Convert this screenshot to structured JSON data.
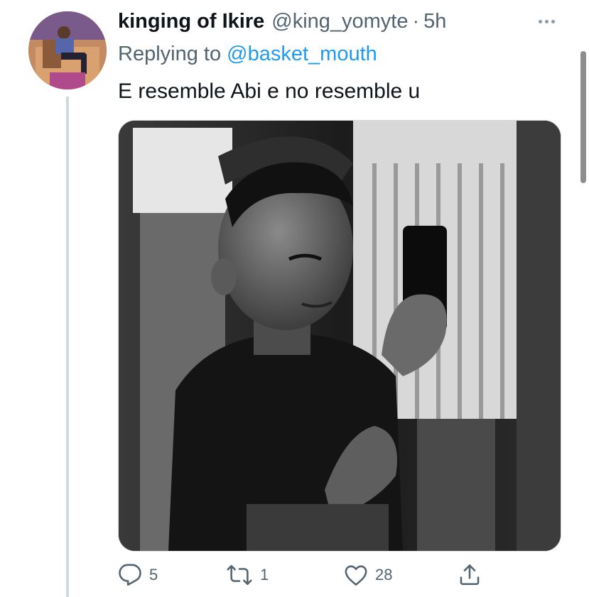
{
  "tweet": {
    "display_name": "kinging of Ikire",
    "handle": "@king_yomyte",
    "separator": "·",
    "time": "5h",
    "replying_prefix": "Replying to",
    "replying_to": "@basket_mouth",
    "text": "E resemble Abi e no resemble u",
    "media": {
      "kind": "photo",
      "style": "black-and-white"
    }
  },
  "actions": {
    "reply_icon": "reply-icon",
    "reply_count": "5",
    "retweet_icon": "retweet-icon",
    "retweet_count": "1",
    "like_icon": "heart-icon",
    "like_count": "28",
    "share_icon": "share-icon"
  },
  "colors": {
    "text_primary": "#0f1419",
    "text_secondary": "#536471",
    "link": "#1d9bf0",
    "thread_line": "#cfd9de"
  }
}
